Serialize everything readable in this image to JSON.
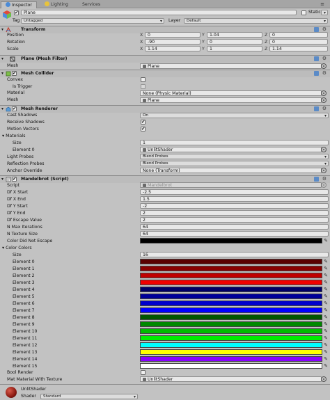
{
  "tabs": [
    {
      "label": "Inspector",
      "icon": "inspector-icon",
      "active": true
    },
    {
      "label": "Lighting",
      "icon": "lighting-icon",
      "active": false
    },
    {
      "label": "Services",
      "icon": "",
      "active": false
    }
  ],
  "object": {
    "name": "Plane",
    "active": true,
    "static_label": "Static",
    "tag_label": "Tag",
    "tag_value": "Untagged",
    "layer_label": "Layer",
    "layer_value": "Default"
  },
  "transform": {
    "title": "Transform",
    "rows": [
      {
        "label": "Position",
        "x": "0",
        "y": "1.04",
        "z": "0"
      },
      {
        "label": "Rotation",
        "x": "-90",
        "y": "0",
        "z": "0"
      },
      {
        "label": "Scale",
        "x": "1.14",
        "y": "1",
        "z": "1.14"
      }
    ],
    "axes": [
      "X",
      "Y",
      "Z"
    ]
  },
  "mesh_filter": {
    "title": "Plane (Mesh Filter)",
    "mesh_label": "Mesh",
    "mesh_value": "Plane"
  },
  "mesh_collider": {
    "title": "Mesh Collider",
    "enabled": true,
    "convex_label": "Convex",
    "is_trigger_label": "Is Trigger",
    "material_label": "Material",
    "material_value": "None (Physic Material)",
    "mesh_label": "Mesh",
    "mesh_value": "Plane"
  },
  "mesh_renderer": {
    "title": "Mesh Renderer",
    "enabled": true,
    "cast_shadows_label": "Cast Shadows",
    "cast_shadows_value": "On",
    "receive_shadows_label": "Receive Shadows",
    "motion_vectors_label": "Motion Vectors",
    "materials_label": "Materials",
    "size_label": "Size",
    "size_value": "1",
    "element0_label": "Element 0",
    "element0_value": "UnlitShader",
    "light_probes_label": "Light Probes",
    "light_probes_value": "Blend Probes",
    "reflection_probes_label": "Reflection Probes",
    "reflection_probes_value": "Blend Probes",
    "anchor_override_label": "Anchor Override",
    "anchor_override_value": "None (Transform)"
  },
  "mandelbrot": {
    "title": "Mandelbrot (Script)",
    "enabled": true,
    "script_label": "Script",
    "script_value": "Mandelbrot",
    "fields": [
      {
        "label": "Df X Start",
        "value": "-2.5"
      },
      {
        "label": "Df X End",
        "value": "1.5"
      },
      {
        "label": "Df Y Start",
        "value": "-2"
      },
      {
        "label": "Df Y End",
        "value": "2"
      },
      {
        "label": "Df Escape Value",
        "value": "2"
      },
      {
        "label": "N Max Iterations",
        "value": "64"
      },
      {
        "label": "N Texture Size",
        "value": "64"
      }
    ],
    "color_escape_label": "Color Did Not Escape",
    "color_escape_value": "#000000",
    "color_colors_label": "Color Colors",
    "cc_size_label": "Size",
    "cc_size_value": "16",
    "colors": [
      {
        "label": "Element 0",
        "color": "#5a0000"
      },
      {
        "label": "Element 1",
        "color": "#8a0000"
      },
      {
        "label": "Element 2",
        "color": "#c00000"
      },
      {
        "label": "Element 3",
        "color": "#f00000"
      },
      {
        "label": "Element 4",
        "color": "#000066"
      },
      {
        "label": "Element 5",
        "color": "#000099"
      },
      {
        "label": "Element 6",
        "color": "#0000cc"
      },
      {
        "label": "Element 7",
        "color": "#0000ff"
      },
      {
        "label": "Element 8",
        "color": "#005500"
      },
      {
        "label": "Element 9",
        "color": "#008800"
      },
      {
        "label": "Element 10",
        "color": "#00bb00"
      },
      {
        "label": "Element 11",
        "color": "#00ee00"
      },
      {
        "label": "Element 12",
        "color": "#00ffff"
      },
      {
        "label": "Element 13",
        "color": "#ffff00"
      },
      {
        "label": "Element 14",
        "color": "#8800ff"
      },
      {
        "label": "Element 15",
        "color": "#ffffff"
      }
    ],
    "bool_render_label": "Bool Render",
    "mat_label": "Mat Material With Texture",
    "mat_value": "UnlitShader"
  },
  "material_footer": {
    "name": "UnlitShader",
    "shader_label": "Shader",
    "shader_value": "Standard"
  }
}
